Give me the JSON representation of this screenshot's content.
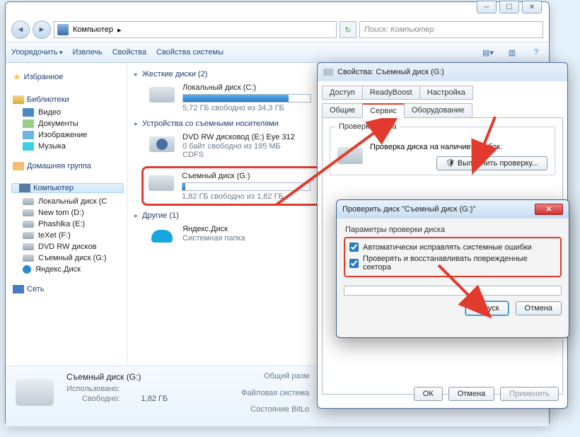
{
  "addr": {
    "location": "Компьютер",
    "arrow": "▸",
    "search_placeholder": "Поиск: Компьютер"
  },
  "toolbar": {
    "organize": "Упорядочить",
    "extract": "Извлечь",
    "props": "Свойства",
    "sysprops": "Свойства системы"
  },
  "sidebar": {
    "favorites": "Избранное",
    "libraries": "Библиотеки",
    "lib_items": [
      "Видео",
      "Документы",
      "Изображение",
      "Музыка"
    ],
    "homegroup": "Домашняя группа",
    "computer": "Компьютер",
    "computer_items": [
      "Локальный диск (C",
      "New tom (D:)",
      "Phashlka (E:)",
      "teXet (F:)",
      "DVD RW дисков",
      "Съемный диск (G:)",
      "Яндекс.Диск"
    ],
    "network": "Сеть"
  },
  "content": {
    "hdd_head": "Жесткие диски (2)",
    "local_c": {
      "name": "Локальный диск (C:)",
      "sub": "5,72 ГБ свободно из 34,3 ГБ",
      "fill": 83
    },
    "removable_head": "Устройства со съемными носителями",
    "dvd": {
      "name": "DVD RW дисковод (E:) Eye 312",
      "sub": "0 байт свободно из 195 МБ",
      "type": "CDFS"
    },
    "usb": {
      "name": "Съемный диск (G:)",
      "sub": "1,82 ГБ свободно из 1,82 ГБ",
      "fill": 2
    },
    "other_head": "Другие (1)",
    "yadisk": {
      "name": "Яндекс.Диск",
      "sub": "Системная папка"
    }
  },
  "details": {
    "title": "Съемный диск (G:)",
    "rows": [
      [
        "Использовано:",
        ""
      ],
      [
        "Свободно:",
        "1,82 ГБ"
      ]
    ],
    "right": [
      [
        "Общий разм",
        ""
      ],
      [
        "Файловая система",
        ""
      ],
      [
        "Состояние BitLo",
        ""
      ]
    ]
  },
  "props": {
    "title": "Свойства: Съемный диск (G:)",
    "tabs_top": [
      "Доступ",
      "ReadyBoost",
      "Настройка"
    ],
    "tabs_bot": [
      "Общие",
      "Сервис",
      "Оборудование"
    ],
    "check_group": "Проверка диска",
    "check_desc": "Проверка диска на наличие ошибок.",
    "check_btn": "Выполнить проверку...",
    "ok": "ОК",
    "cancel": "Отмена",
    "apply": "Применить"
  },
  "checkdisk": {
    "title": "Проверить диск \"Съемный диск (G:)\"",
    "group": "Параметры проверки диска",
    "opt1": "Автоматически исправлять системные ошибки",
    "opt2": "Проверять и восстанавливать поврежденные сектора",
    "start": "Запуск",
    "cancel": "Отмена"
  }
}
